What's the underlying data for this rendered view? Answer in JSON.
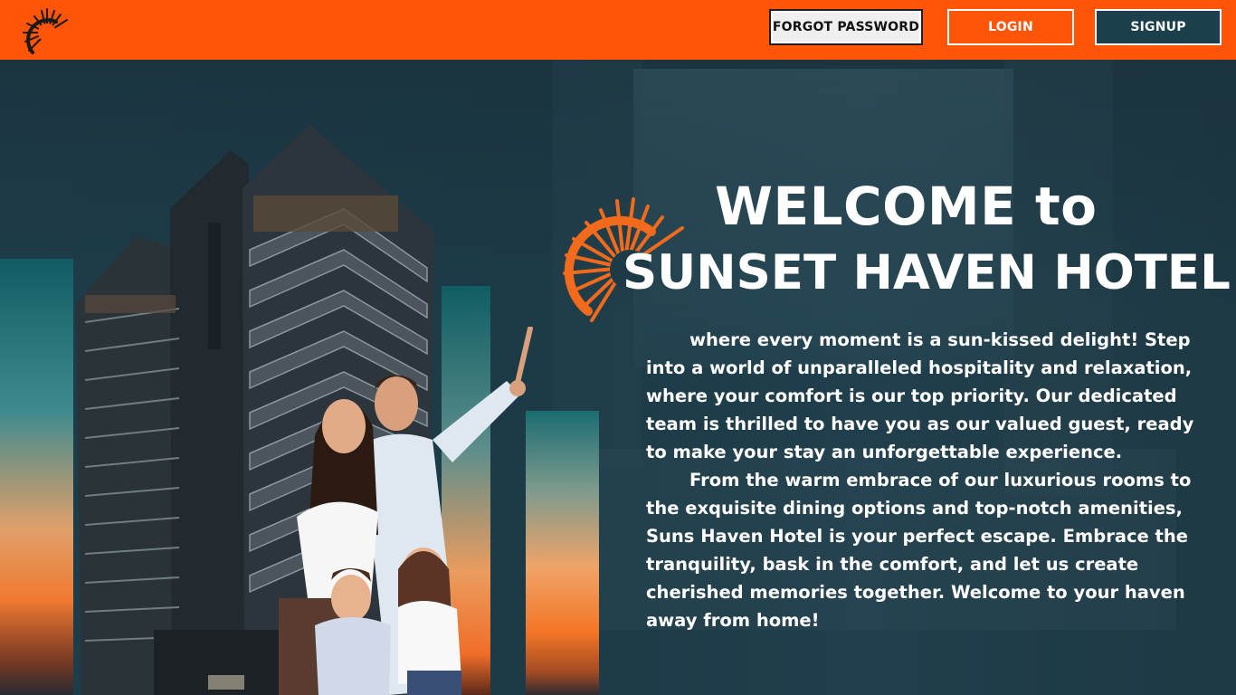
{
  "header": {
    "logo_icon": "sun-rays-logo-icon",
    "buttons": {
      "forgot_password": "FORGOT PASSWORD",
      "login": "LOGIN",
      "signup": "SIGNUP"
    }
  },
  "hero": {
    "sun_icon": "sunset-sun-icon",
    "welcome": "WELCOME to",
    "hotel_name": "SUNSET HAVEN HOTEL",
    "paragraphs": [
      "where every moment is a sun-kissed delight! Step into a world of unparalleled hospitality and relaxation, where your comfort is our top priority. Our dedicated team is thrilled to have you as our valued guest, ready to make your stay an unforgettable experience.",
      "From the warm embrace of our luxurious rooms to the exquisite dining options and top-notch amenities, Suns Haven Hotel is your perfect escape. Embrace the tranquility, bask in the comfort, and let us create cherished memories together. Welcome to your haven away from home!"
    ]
  },
  "colors": {
    "header_orange": "#ff5508",
    "signup_teal": "#1b3f4d",
    "hero_background": "#1c3b47",
    "sun_orange": "#f26a1b"
  }
}
